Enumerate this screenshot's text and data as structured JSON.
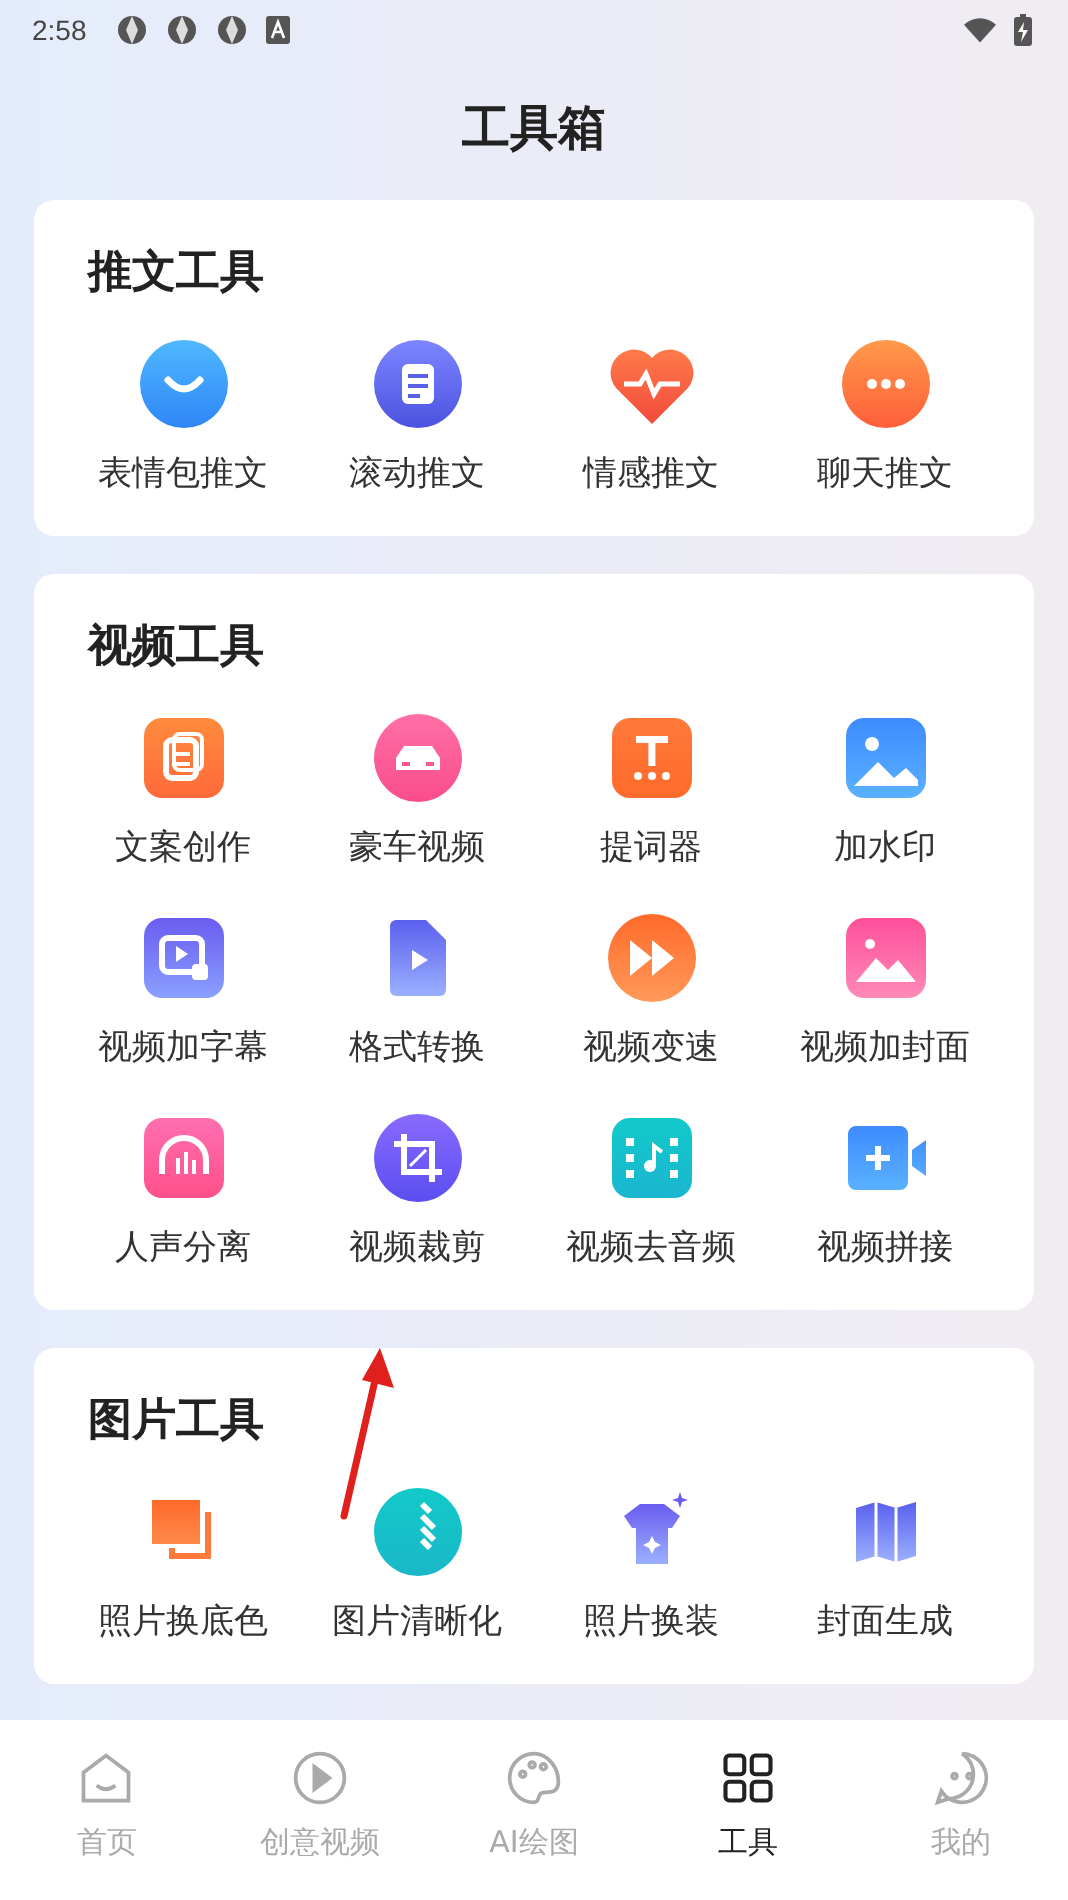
{
  "status_bar": {
    "time": "2:58"
  },
  "title": "工具箱",
  "sections": [
    {
      "title": "推文工具",
      "tools": [
        "表情包推文",
        "滚动推文",
        "情感推文",
        "聊天推文"
      ]
    },
    {
      "title": "视频工具",
      "tools": [
        "文案创作",
        "豪车视频",
        "提词器",
        "加水印",
        "视频加字幕",
        "格式转换",
        "视频变速",
        "视频加封面",
        "人声分离",
        "视频裁剪",
        "视频去音频",
        "视频拼接"
      ]
    },
    {
      "title": "图片工具",
      "tools": [
        "照片换底色",
        "图片清晰化",
        "照片换装",
        "封面生成"
      ]
    }
  ],
  "nav": [
    {
      "label": "首页",
      "selected": false
    },
    {
      "label": "创意视频",
      "selected": false
    },
    {
      "label": "AI绘图",
      "selected": false
    },
    {
      "label": "工具",
      "selected": true
    },
    {
      "label": "我的",
      "selected": false
    }
  ]
}
